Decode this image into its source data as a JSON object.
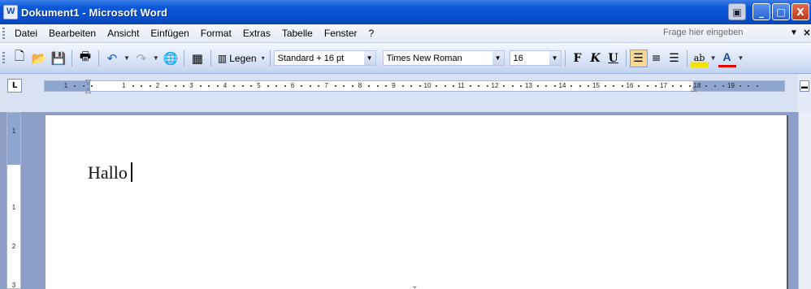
{
  "window": {
    "title": "Dokument1 - Microsoft Word"
  },
  "window_controls": {
    "minimize": "_",
    "restore": "□",
    "close": "X"
  },
  "menu": {
    "items": [
      "Datei",
      "Bearbeiten",
      "Ansicht",
      "Einfügen",
      "Format",
      "Extras",
      "Tabelle",
      "Fenster",
      "?"
    ],
    "help_placeholder": "Frage hier eingeben"
  },
  "toolbar": {
    "legen_label": "Legen",
    "style_value": "Standard + 16 pt",
    "font_value": "Times New Roman",
    "size_value": "16",
    "bold_label": "F",
    "italic_label": "K",
    "underline_label": "U"
  },
  "ruler": {
    "horizontal_numbers": [
      "1",
      "1",
      "2",
      "3",
      "4",
      "5",
      "6",
      "7",
      "8",
      "9",
      "10",
      "11",
      "12",
      "13",
      "14",
      "15",
      "16",
      "17",
      "18",
      "19"
    ],
    "vertical_numbers": [
      "1",
      "1",
      "2",
      "3"
    ]
  },
  "document": {
    "text": "Hallo"
  },
  "colors": {
    "titlebar": "#0a57d8",
    "workspace": "#8d9fc6",
    "active_button": "#f6d890"
  }
}
